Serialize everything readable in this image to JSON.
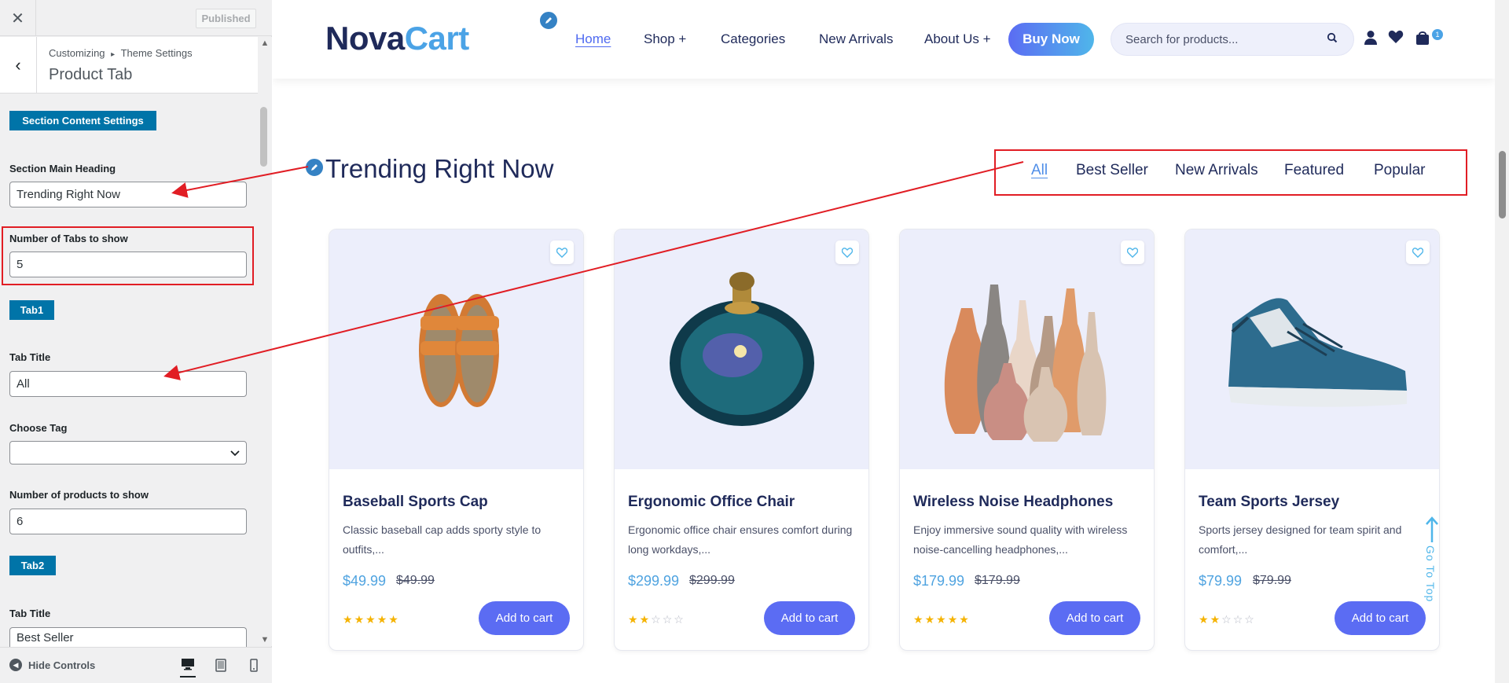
{
  "customizer": {
    "close_icon": "close-icon",
    "published_label": "Published",
    "breadcrumb_part1": "Customizing",
    "breadcrumb_sep": "▸",
    "breadcrumb_part2": "Theme Settings",
    "panel_title": "Product Tab",
    "section_content_settings": "Section Content Settings",
    "main_heading_label": "Section Main Heading",
    "main_heading_value": "Trending Right Now",
    "tabs_count_label": "Number of Tabs to show",
    "tabs_count_value": "5",
    "tab1_tag": "Tab1",
    "tab1_title_label": "Tab Title",
    "tab1_title_value": "All",
    "choose_tag_label": "Choose Tag",
    "choose_tag_value": "",
    "products_count_label": "Number of products to show",
    "products_count_value": "6",
    "tab2_tag": "Tab2",
    "tab2_title_label": "Tab Title",
    "tab2_title_value": "Best Seller",
    "hide_controls_label": "Hide Controls"
  },
  "site": {
    "logo_part1": "Nova",
    "logo_part2": "Cart",
    "nav": [
      "Home",
      "Shop +",
      "Categories",
      "New Arrivals",
      "About Us +"
    ],
    "buy_now": "Buy Now",
    "search_placeholder": "Search for products...",
    "cart_count": "1",
    "section_heading": "Trending Right Now",
    "tabs": [
      "All",
      "Best Seller",
      "New Arrivals",
      "Featured",
      "Popular"
    ],
    "products": [
      {
        "title": "Baseball Sports Cap",
        "desc": "Classic baseball cap adds sporty style to outfits,...",
        "price": "$49.99",
        "old_price": "$49.99",
        "rating": 5,
        "button": "Add to cart"
      },
      {
        "title": "Ergonomic Office Chair",
        "desc": "Ergonomic office chair ensures comfort during long workdays,...",
        "price": "$299.99",
        "old_price": "$299.99",
        "rating": 2,
        "button": "Add to cart"
      },
      {
        "title": "Wireless Noise Headphones",
        "desc": "Enjoy immersive sound quality with wireless noise-cancelling headphones,...",
        "price": "$179.99",
        "old_price": "$179.99",
        "rating": 5,
        "button": "Add to cart"
      },
      {
        "title": "Team Sports Jersey",
        "desc": "Sports jersey designed for team spirit and comfort,...",
        "price": "$79.99",
        "old_price": "$79.99",
        "rating": 2,
        "button": "Add to cart"
      }
    ],
    "go_to_top": "Go To Top"
  },
  "colors": {
    "accent_blue": "#0074a8",
    "brand_navy": "#1f2a5a",
    "brand_sky": "#4ba3e6",
    "button_purple": "#5b6cf3",
    "annotation_red": "#e11d24",
    "star_gold": "#f5b301"
  }
}
